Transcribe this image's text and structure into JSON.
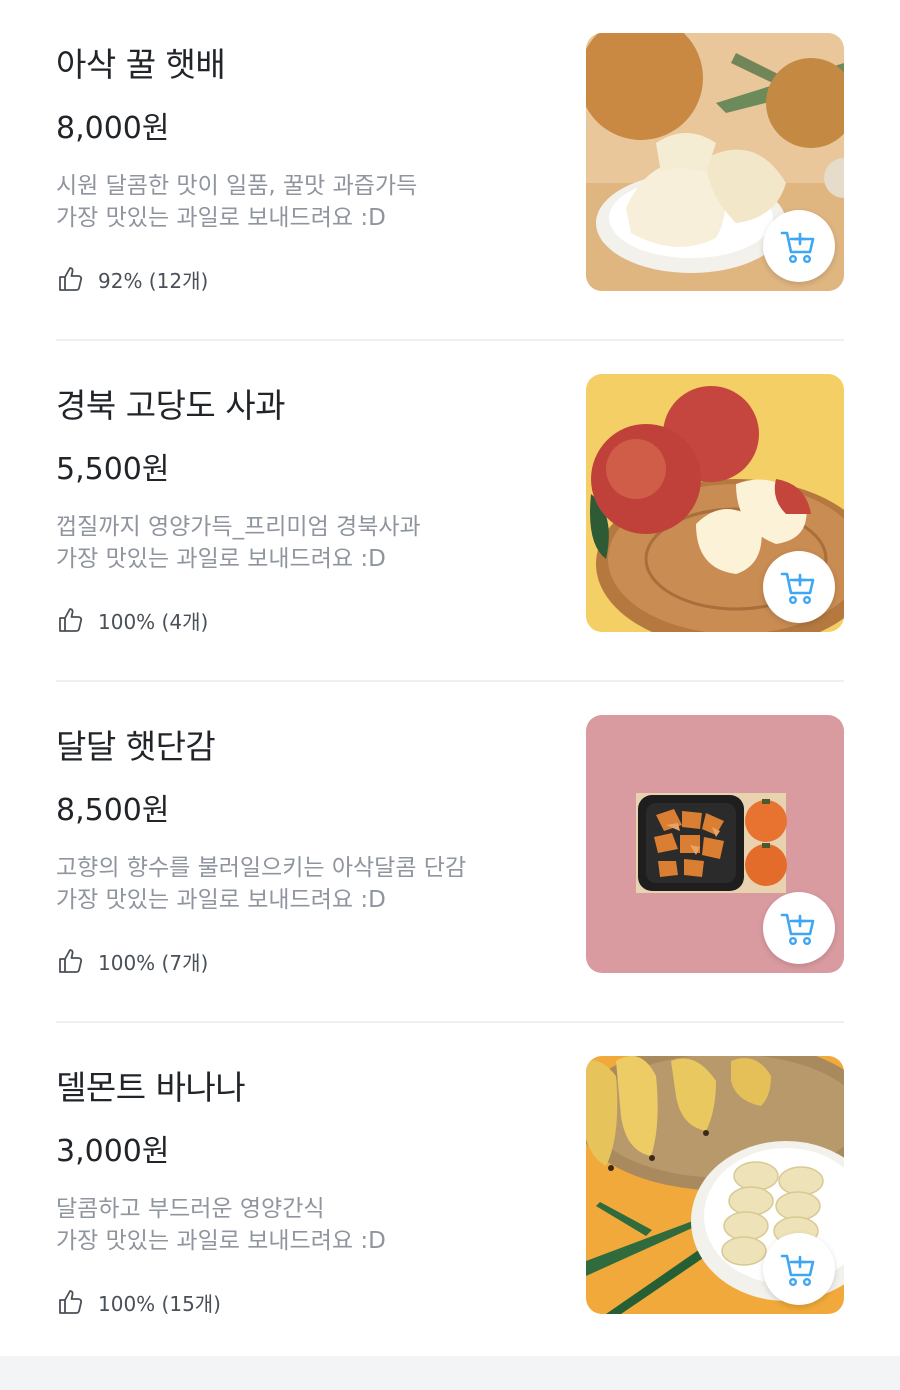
{
  "colors": {
    "title": "#212529",
    "description": "#8f959e",
    "divider": "#eeeff1",
    "accent": "#3ea6f2"
  },
  "icons": {
    "rating": "thumbs-up-icon",
    "cart": "add-to-cart-icon"
  },
  "products": [
    {
      "name": "아삭 꿀 햇배",
      "price": "8,000원",
      "description_line1": "시원 달콤한 맛이 일품, 꿀맛 과즙가득",
      "description_line2": "가장 맛있는 과일로 보내드려요 :D",
      "rating": "92% (12개)",
      "image": "pear"
    },
    {
      "name": "경북 고당도 사과",
      "price": "5,500원",
      "description_line1": "껍질까지 영양가득_프리미엄 경북사과",
      "description_line2": "가장 맛있는 과일로 보내드려요 :D",
      "rating": "100% (4개)",
      "image": "apple"
    },
    {
      "name": "달달 햇단감",
      "price": "8,500원",
      "description_line1": "고향의 향수를 불러일으키는 아삭달콤 단감",
      "description_line2": "가장 맛있는 과일로 보내드려요 :D",
      "rating": "100% (7개)",
      "image": "persimmon"
    },
    {
      "name": "델몬트 바나나",
      "price": "3,000원",
      "description_line1": "달콤하고 부드러운 영양간식",
      "description_line2": "가장 맛있는 과일로 보내드려요 :D",
      "rating": "100% (15개)",
      "image": "banana"
    }
  ]
}
